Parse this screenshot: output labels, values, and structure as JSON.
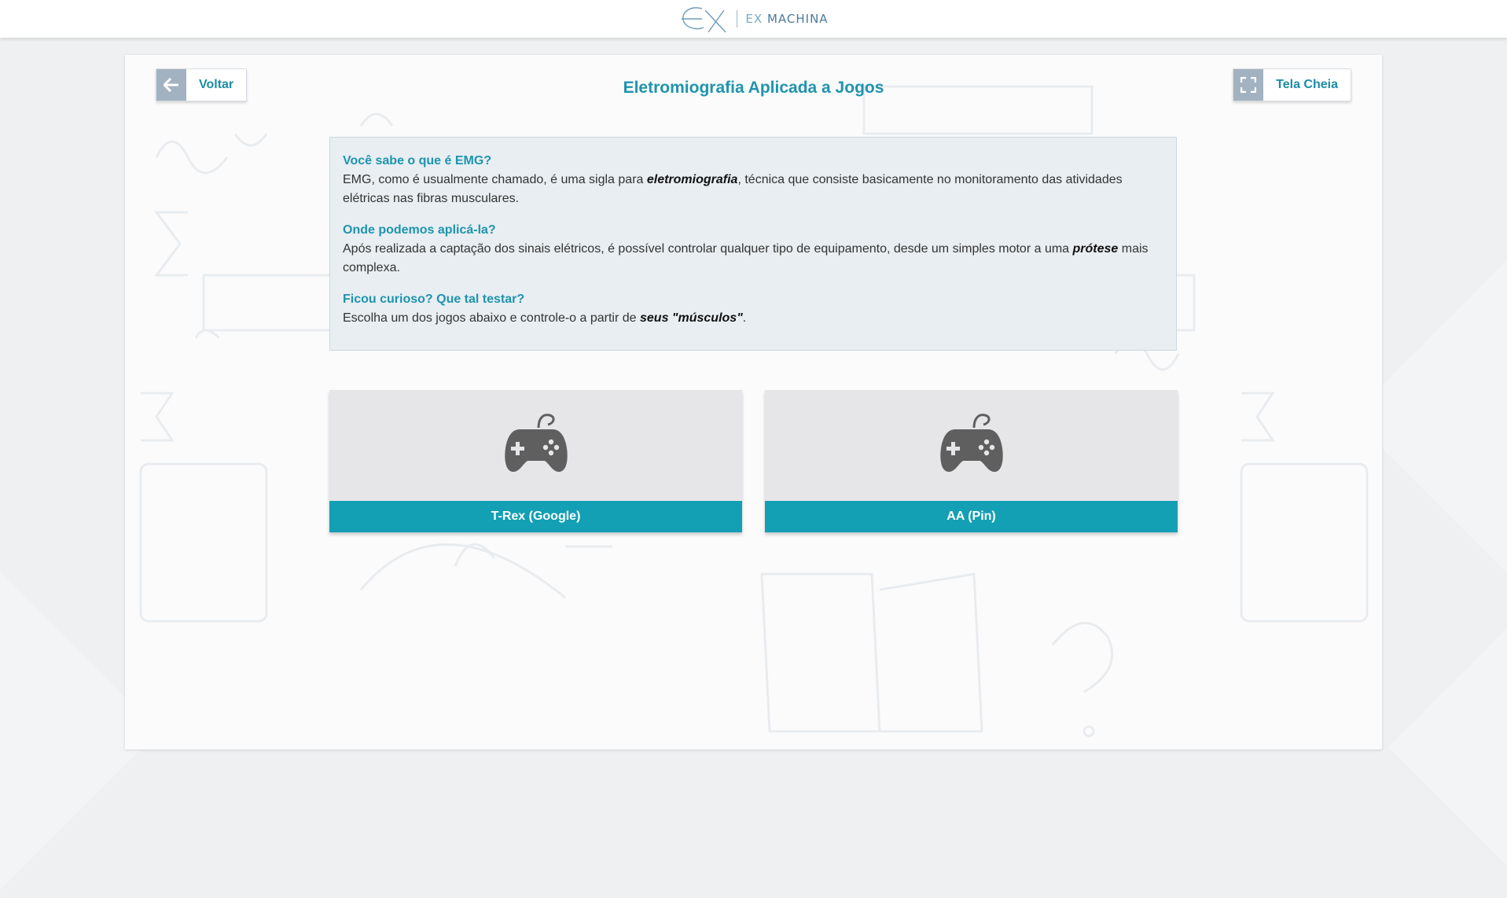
{
  "header": {
    "logo_mark": "ex-machina-logo",
    "logo_prefix": "EX",
    "logo_word": "MACHINA"
  },
  "page": {
    "title": "Eletromiografia Aplicada a Jogos",
    "back_label": "Voltar",
    "fullscreen_label": "Tela Cheia",
    "back_icon": "arrow-left-icon",
    "fullscreen_icon": "fullscreen-icon"
  },
  "info": {
    "q1": "Você sabe o que é EMG?",
    "a1_pre": "EMG, como é usualmente chamado, é uma sigla para ",
    "a1_em": "eletromiografia",
    "a1_post": ", técnica que consiste basicamente no monitoramento das atividades elétricas nas fibras musculares.",
    "q2": "Onde podemos aplicá-la?",
    "a2_pre": "Após realizada a captação dos sinais elétricos, é possível controlar qualquer tipo de equipamento, desde um simples motor a uma ",
    "a2_em": "prótese",
    "a2_post": " mais complexa.",
    "q3": "Ficou curioso? Que tal testar?",
    "a3_pre": "Escolha um dos jogos abaixo e controle-o a partir de ",
    "a3_em": "seus \"músculos\"",
    "a3_post": "."
  },
  "games": [
    {
      "label": "T-Rex (Google)",
      "icon": "gamepad-icon"
    },
    {
      "label": "AA (Pin)",
      "icon": "gamepad-icon"
    }
  ],
  "colors": {
    "accent": "#139fb4",
    "title": "#1f94ad",
    "button_icon_bg": "#a3b2c0"
  }
}
